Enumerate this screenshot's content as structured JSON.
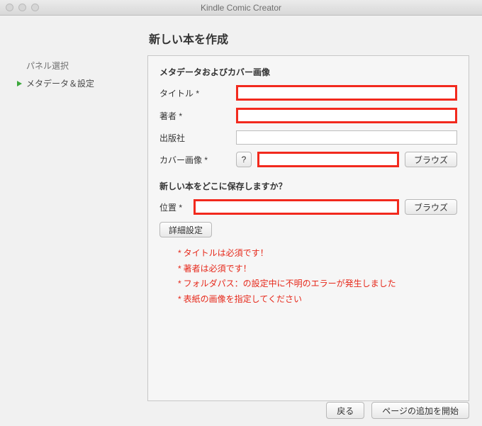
{
  "window": {
    "title": "Kindle Comic Creator"
  },
  "sidebar": {
    "items": [
      {
        "label": "パネル選択",
        "active": false
      },
      {
        "label": "メタデータ＆設定",
        "active": true
      }
    ]
  },
  "main": {
    "title": "新しい本を作成",
    "section1": {
      "heading": "メタデータおよびカバー画像",
      "title_label": "タイトル *",
      "author_label": "著者 *",
      "publisher_label": "出版社",
      "cover_label": "カバー画像 *",
      "help_label": "?",
      "browse_label": "ブラウズ"
    },
    "section2": {
      "heading": "新しい本をどこに保存しますか？",
      "location_label": "位置 *",
      "browse_label": "ブラウズ"
    },
    "advanced_label": "詳細設定",
    "errors": [
      "タイトルは必須です！",
      "著者は必須です！",
      "フォルダパス：の設定中に不明のエラーが発生しました",
      "表紙の画像を指定してください"
    ],
    "inputs": {
      "title_value": "",
      "author_value": "",
      "publisher_value": "",
      "cover_value": "",
      "location_value": ""
    }
  },
  "footer": {
    "back_label": "戻る",
    "start_label": "ページの追加を開始"
  }
}
